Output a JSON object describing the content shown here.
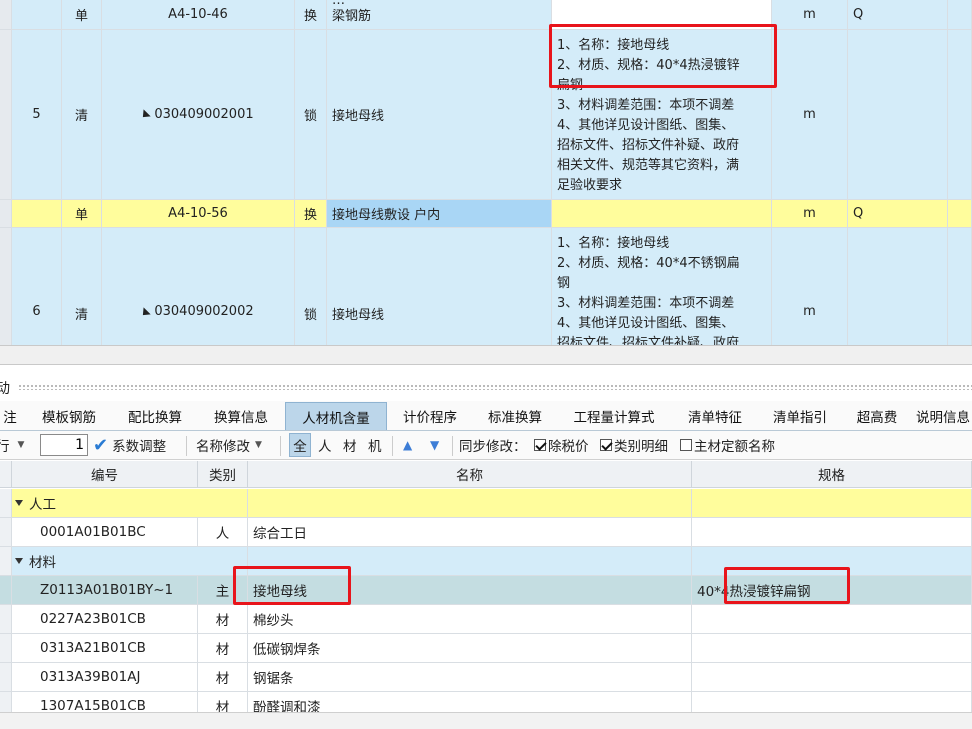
{
  "upper_rows": [
    {
      "seq": "",
      "type": "单",
      "code": "A4-10-46",
      "lock": "换",
      "name_lines": [
        "…",
        "梁钢筋"
      ],
      "desc_lines": [],
      "unit": "m",
      "q": "Q"
    },
    {
      "seq": "5",
      "type": "清",
      "code": "030409002001",
      "lock": "锁",
      "name": "接地母线",
      "desc_lines": [
        "1、名称：接地母线",
        "2、材质、规格：40*4热浸镀锌",
        "扁钢",
        "3、材料调差范围：本项不调差",
        "4、其他详见设计图纸、图集、",
        "招标文件、招标文件补疑、政府",
        "相关文件、规范等其它资料，满",
        "足验收要求"
      ],
      "unit": "m"
    },
    {
      "seq": "",
      "type": "单",
      "code": "A4-10-56",
      "lock": "换",
      "name": "接地母线敷设 户内",
      "unit": "m",
      "q": "Q"
    },
    {
      "seq": "6",
      "type": "清",
      "code": "030409002002",
      "lock": "锁",
      "name": "接地母线",
      "desc_lines": [
        "1、名称：接地母线",
        "2、材质、规格：40*4不锈钢扁",
        "钢",
        "3、材料调差范围：本项不调差",
        "4、其他详见设计图纸、图集、",
        "招标文件、招标文件补疑、政府"
      ],
      "unit": "m"
    }
  ],
  "panel_label": "动",
  "tabs": [
    "注",
    "模板钢筋",
    "配比换算",
    "换算信息",
    "人材机含量",
    "计价程序",
    "标准换算",
    "工程量计算式",
    "清单特征",
    "清单指引",
    "超高费",
    "说明信息"
  ],
  "active_tab": "人材机含量",
  "toolbar": {
    "row_label": "行",
    "factor_value": "1",
    "factor_adjust": "系数调整",
    "rename": "名称修改",
    "filter_all": "全",
    "filter_labor": "人",
    "filter_material": "材",
    "filter_machine": "机",
    "sync_label": "同步修改：",
    "tax_price": "除税价",
    "category_detail": "类别明细",
    "main_quota_name": "主材定额名称"
  },
  "grid": {
    "headers": {
      "code": "编号",
      "category": "类别",
      "name": "名称",
      "spec": "规格"
    },
    "groups": [
      {
        "label": "人工",
        "rows": [
          {
            "code": "0001A01B01BC",
            "category": "人",
            "name": "综合工日",
            "spec": ""
          }
        ]
      },
      {
        "label": "材料",
        "rows": [
          {
            "code": "Z0113A01B01BY~1",
            "category": "主",
            "name": "接地母线",
            "spec": "40*4热浸镀锌扁钢",
            "selected": true
          },
          {
            "code": "0227A23B01CB",
            "category": "材",
            "name": "棉纱头",
            "spec": ""
          },
          {
            "code": "0313A21B01CB",
            "category": "材",
            "name": "低碳钢焊条",
            "spec": ""
          },
          {
            "code": "0313A39B01AJ",
            "category": "材",
            "name": "钢锯条",
            "spec": ""
          },
          {
            "code": "1307A15B01CB",
            "category": "材",
            "name": "酚醛调和漆",
            "spec": ""
          }
        ]
      }
    ]
  },
  "colors": {
    "row_blue": "#d4ecf9",
    "row_yellow": "#fffd9c",
    "selected": "#c4dde1",
    "highlight": "#e8141b"
  }
}
